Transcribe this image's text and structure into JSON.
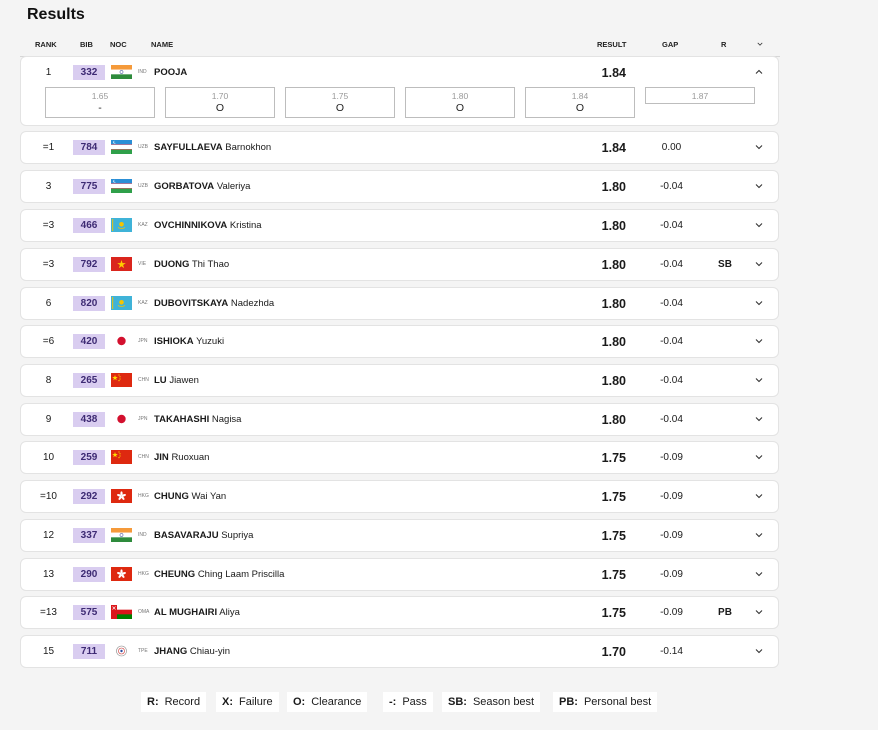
{
  "page_title": "Results",
  "headers": {
    "rank": "RANK",
    "bib": "BIB",
    "noc": "NOC",
    "name": "NAME",
    "result": "RESULT",
    "gap": "GAP",
    "r": "R"
  },
  "rows": [
    {
      "rank": "1",
      "bib": "332",
      "noc": "IND",
      "flag": "ind",
      "surname": "POOJA",
      "given": "",
      "result": "1.84",
      "gap": "",
      "r": "",
      "expanded": true,
      "attempts": [
        {
          "height": "1.65",
          "mark": "-"
        },
        {
          "height": "1.70",
          "mark": "O"
        },
        {
          "height": "1.75",
          "mark": "O"
        },
        {
          "height": "1.80",
          "mark": "O"
        },
        {
          "height": "1.84",
          "mark": "O"
        },
        {
          "height": "1.87",
          "mark": ""
        }
      ]
    },
    {
      "rank": "=1",
      "bib": "784",
      "noc": "UZB",
      "flag": "uzb",
      "surname": "SAYFULLAEVA",
      "given": "Barnokhon",
      "result": "1.84",
      "gap": "0.00",
      "r": ""
    },
    {
      "rank": "3",
      "bib": "775",
      "noc": "UZB",
      "flag": "uzb",
      "surname": "GORBATOVA",
      "given": "Valeriya",
      "result": "1.80",
      "gap": "-0.04",
      "r": ""
    },
    {
      "rank": "=3",
      "bib": "466",
      "noc": "KAZ",
      "flag": "kaz",
      "surname": "OVCHINNIKOVA",
      "given": "Kristina",
      "result": "1.80",
      "gap": "-0.04",
      "r": ""
    },
    {
      "rank": "=3",
      "bib": "792",
      "noc": "VIE",
      "flag": "vie",
      "surname": "DUONG",
      "given": "Thi Thao",
      "result": "1.80",
      "gap": "-0.04",
      "r": "SB"
    },
    {
      "rank": "6",
      "bib": "820",
      "noc": "KAZ",
      "flag": "kaz",
      "surname": "DUBOVITSKAYA",
      "given": "Nadezhda",
      "result": "1.80",
      "gap": "-0.04",
      "r": ""
    },
    {
      "rank": "=6",
      "bib": "420",
      "noc": "JPN",
      "flag": "jpn",
      "surname": "ISHIOKA",
      "given": "Yuzuki",
      "result": "1.80",
      "gap": "-0.04",
      "r": ""
    },
    {
      "rank": "8",
      "bib": "265",
      "noc": "CHN",
      "flag": "chn",
      "surname": "LU",
      "given": "Jiawen",
      "result": "1.80",
      "gap": "-0.04",
      "r": ""
    },
    {
      "rank": "9",
      "bib": "438",
      "noc": "JPN",
      "flag": "jpn",
      "surname": "TAKAHASHI",
      "given": "Nagisa",
      "result": "1.80",
      "gap": "-0.04",
      "r": ""
    },
    {
      "rank": "10",
      "bib": "259",
      "noc": "CHN",
      "flag": "chn",
      "surname": "JIN",
      "given": "Ruoxuan",
      "result": "1.75",
      "gap": "-0.09",
      "r": ""
    },
    {
      "rank": "=10",
      "bib": "292",
      "noc": "HKG",
      "flag": "hkg",
      "surname": "CHUNG",
      "given": "Wai Yan",
      "result": "1.75",
      "gap": "-0.09",
      "r": ""
    },
    {
      "rank": "12",
      "bib": "337",
      "noc": "IND",
      "flag": "ind",
      "surname": "BASAVARAJU",
      "given": "Supriya",
      "result": "1.75",
      "gap": "-0.09",
      "r": ""
    },
    {
      "rank": "13",
      "bib": "290",
      "noc": "HKG",
      "flag": "hkg",
      "surname": "CHEUNG",
      "given": "Ching Laam Priscilla",
      "result": "1.75",
      "gap": "-0.09",
      "r": ""
    },
    {
      "rank": "=13",
      "bib": "575",
      "noc": "OMA",
      "flag": "oma",
      "surname": "AL MUGHAIRI",
      "given": "Aliya",
      "result": "1.75",
      "gap": "-0.09",
      "r": "PB"
    },
    {
      "rank": "15",
      "bib": "711",
      "noc": "TPE",
      "flag": "tpe",
      "surname": "JHANG",
      "given": "Chiau-yin",
      "result": "1.70",
      "gap": "-0.14",
      "r": ""
    }
  ],
  "legend": [
    {
      "key": "R:",
      "label": "Record"
    },
    {
      "key": "X:",
      "label": "Failure"
    },
    {
      "key": "O:",
      "label": "Clearance"
    },
    {
      "key": "-:",
      "label": "Pass"
    },
    {
      "key": "SB:",
      "label": "Season best"
    },
    {
      "key": "PB:",
      "label": "Personal best"
    }
  ],
  "colors": {
    "bib_bg": "#d9cdf0",
    "bib_text": "#3d2a73"
  }
}
